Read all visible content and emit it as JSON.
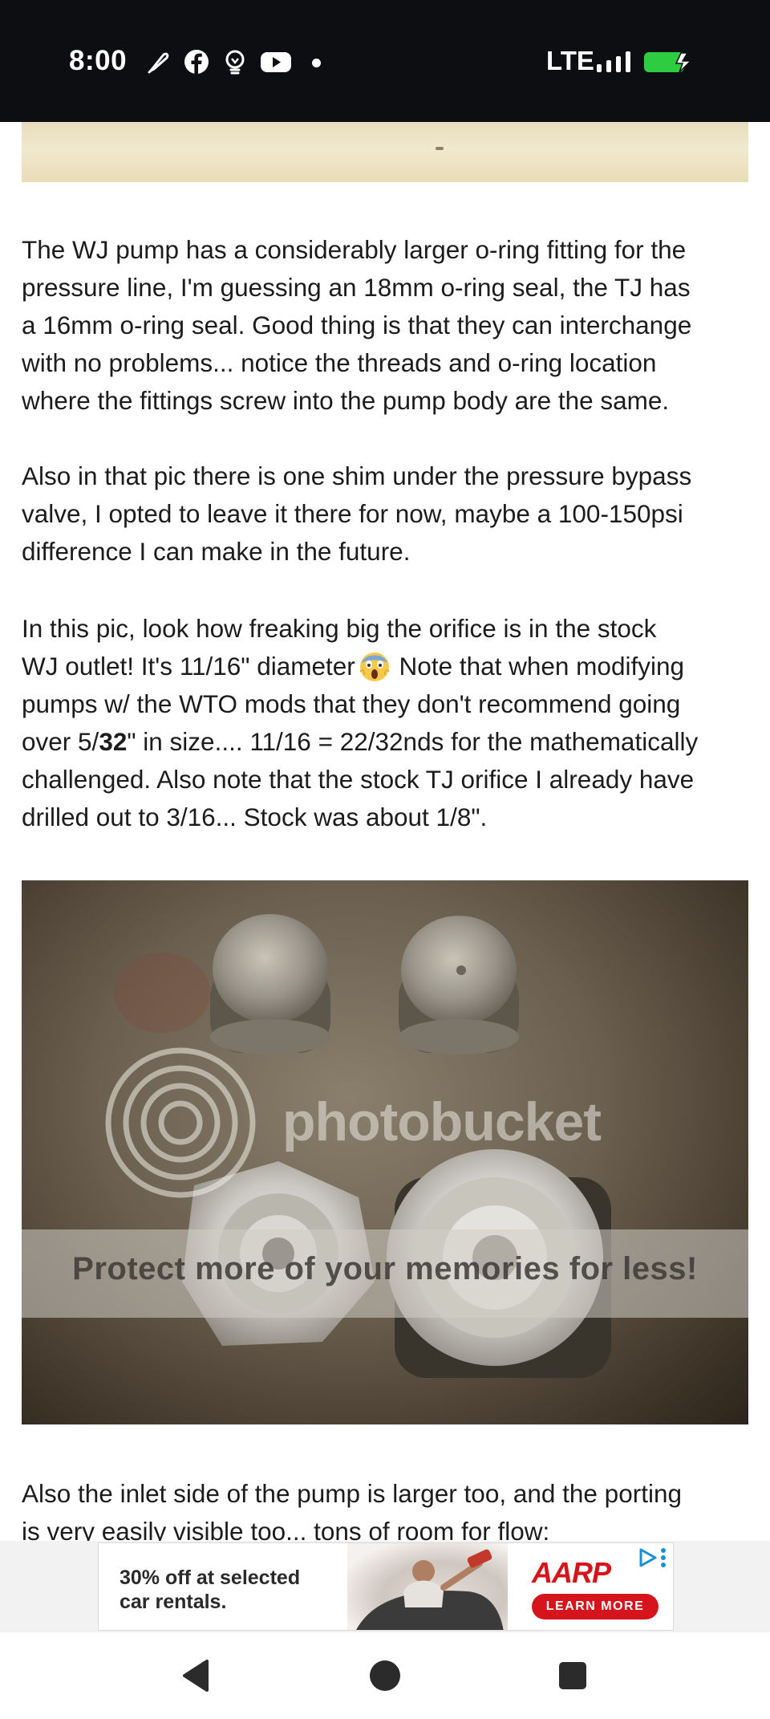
{
  "status_bar": {
    "time": "8:00",
    "notification_icons": [
      "feather-icon",
      "facebook-icon",
      "lightbulb-icon",
      "youtube-icon"
    ],
    "network": "LTE",
    "signal_icon": "signal-bars-icon",
    "battery_icon": "battery-charging-icon",
    "battery_color": "#2ecc40"
  },
  "article": {
    "para1": [
      "The WJ pump has a considerably larger o-ring fitting for the",
      "pressure line, I'm guessing an 18mm o-ring seal, the TJ has",
      "a 16mm o-ring seal. Good thing is that they can interchange",
      "with no problems... notice the threads and o-ring location",
      "where the fittings screw into the pump body are the same."
    ],
    "para2": [
      "Also in that pic there is one shim under the pressure bypass",
      "valve, I opted to leave it there for now, maybe a 100-150psi",
      "difference I can make in the future."
    ],
    "para3": {
      "line1": "In this pic, look how freaking big the orifice is in the stock",
      "line2_a": "WJ outlet! It's 11/16\" diameter",
      "line2_b": " Note that when modifying",
      "line3": "pumps w/ the WTO mods that they don't recommend going",
      "line4_a": "over 5/",
      "line4_bold": "32",
      "line4_b": "\" in size.... 11/16 = 22/32nds for the mathematically",
      "line5": "challenged. Also note that the stock TJ orifice I already have",
      "line6": "drilled out to 3/16... Stock was about 1/8\"."
    },
    "emoji_icon": "face-screaming-emoji-icon",
    "photo": {
      "logo_text": "photobucket",
      "watermark": "Protect more of your memories for less!"
    },
    "para4": [
      "Also the inlet side of the pump is larger too, and the porting",
      "is very easily visible too... tons of room for flow:"
    ]
  },
  "ad": {
    "line1": "30% off at selected",
    "line2": "car rentals.",
    "brand": "AARP",
    "cta": "LEARN MORE",
    "brand_color": "#d5141b",
    "adchoices_icon": "adchoices-icon"
  },
  "nav": {
    "back_icon": "back-triangle-icon",
    "home_icon": "home-circle-icon",
    "recents_icon": "recents-square-icon"
  }
}
